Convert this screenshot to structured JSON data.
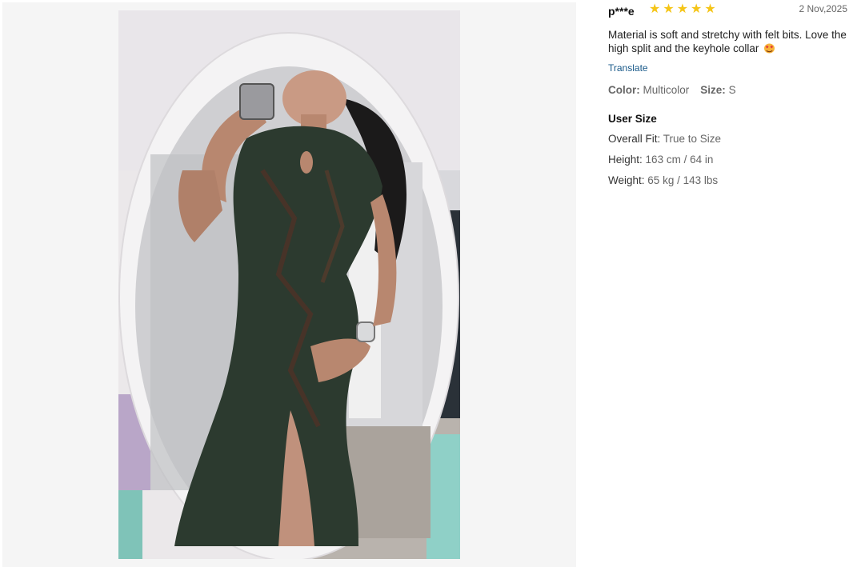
{
  "review": {
    "username": "p***e",
    "rating": 5,
    "date": "2 Nov,2025",
    "text": "Material is soft and stretchy with felt bits. Love the high split and the keyhole collar",
    "translate_label": "Translate",
    "color_label": "Color:",
    "color_value": "Multicolor",
    "size_label": "Size:",
    "size_value": "S"
  },
  "user_size": {
    "title": "User Size",
    "overall_fit_label": "Overall Fit:",
    "overall_fit_value": "True to Size",
    "height_label": "Height:",
    "height_value": "163 cm / 64 in",
    "weight_label": "Weight:",
    "weight_value": "65 kg / 143 lbs"
  },
  "colors": {
    "star": "#f5c518",
    "link": "#1a5a8a",
    "panel_bg": "#f5f5f5"
  },
  "icons": {
    "star": "star-icon",
    "emoji": "heart-eyes-emoji-icon"
  }
}
